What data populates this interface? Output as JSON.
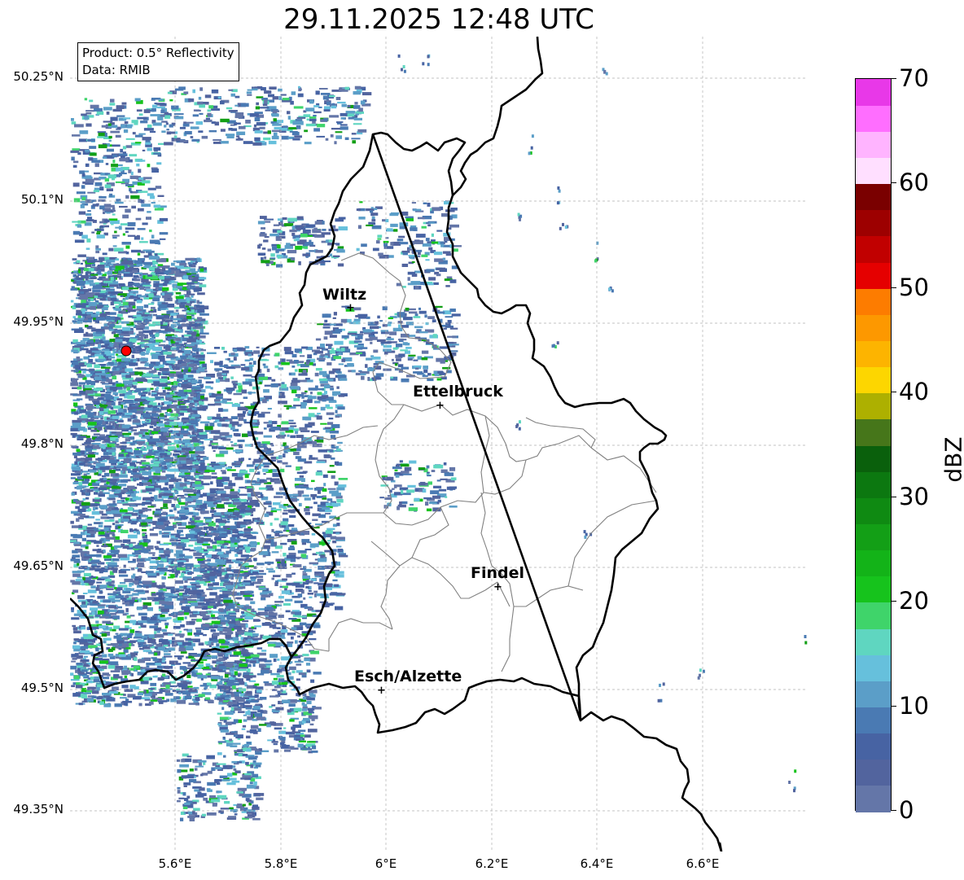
{
  "title": "29.11.2025 12:48 UTC",
  "info": {
    "product": "Product: 0.5° Reflectivity",
    "data": "Data: RMIB"
  },
  "lat_ticks": [
    "50.25°N",
    "50.1°N",
    "49.95°N",
    "49.8°N",
    "49.65°N",
    "49.5°N",
    "49.35°N"
  ],
  "lon_ticks": [
    "5.6°E",
    "5.8°E",
    "6°E",
    "6.2°E",
    "6.4°E",
    "6.6°E"
  ],
  "cities": [
    {
      "name": "Wiltz"
    },
    {
      "name": "Ettelbruck"
    },
    {
      "name": "Findel"
    },
    {
      "name": "Esch/Alzette"
    }
  ],
  "colorbar": {
    "label": "dBZ",
    "ticks": [
      "0",
      "10",
      "20",
      "30",
      "40",
      "50",
      "60",
      "70"
    ],
    "colors": [
      "#6476a8",
      "#52649e",
      "#4763a3",
      "#4a7ab3",
      "#5b9ec8",
      "#66c0dc",
      "#5fd6c0",
      "#3fd46a",
      "#16c31c",
      "#13b318",
      "#139f16",
      "#0f8a12",
      "#0c7810",
      "#0a600c",
      "#46761a",
      "#adb000",
      "#fdd600",
      "#fdb400",
      "#fd9800",
      "#fd7c00",
      "#e50000",
      "#c10000",
      "#9d0000",
      "#7a0000",
      "#ffdfff",
      "#ffb4ff",
      "#ff6eff",
      "#e838e8"
    ]
  },
  "radar_marker": {
    "color": "#ff0000"
  }
}
